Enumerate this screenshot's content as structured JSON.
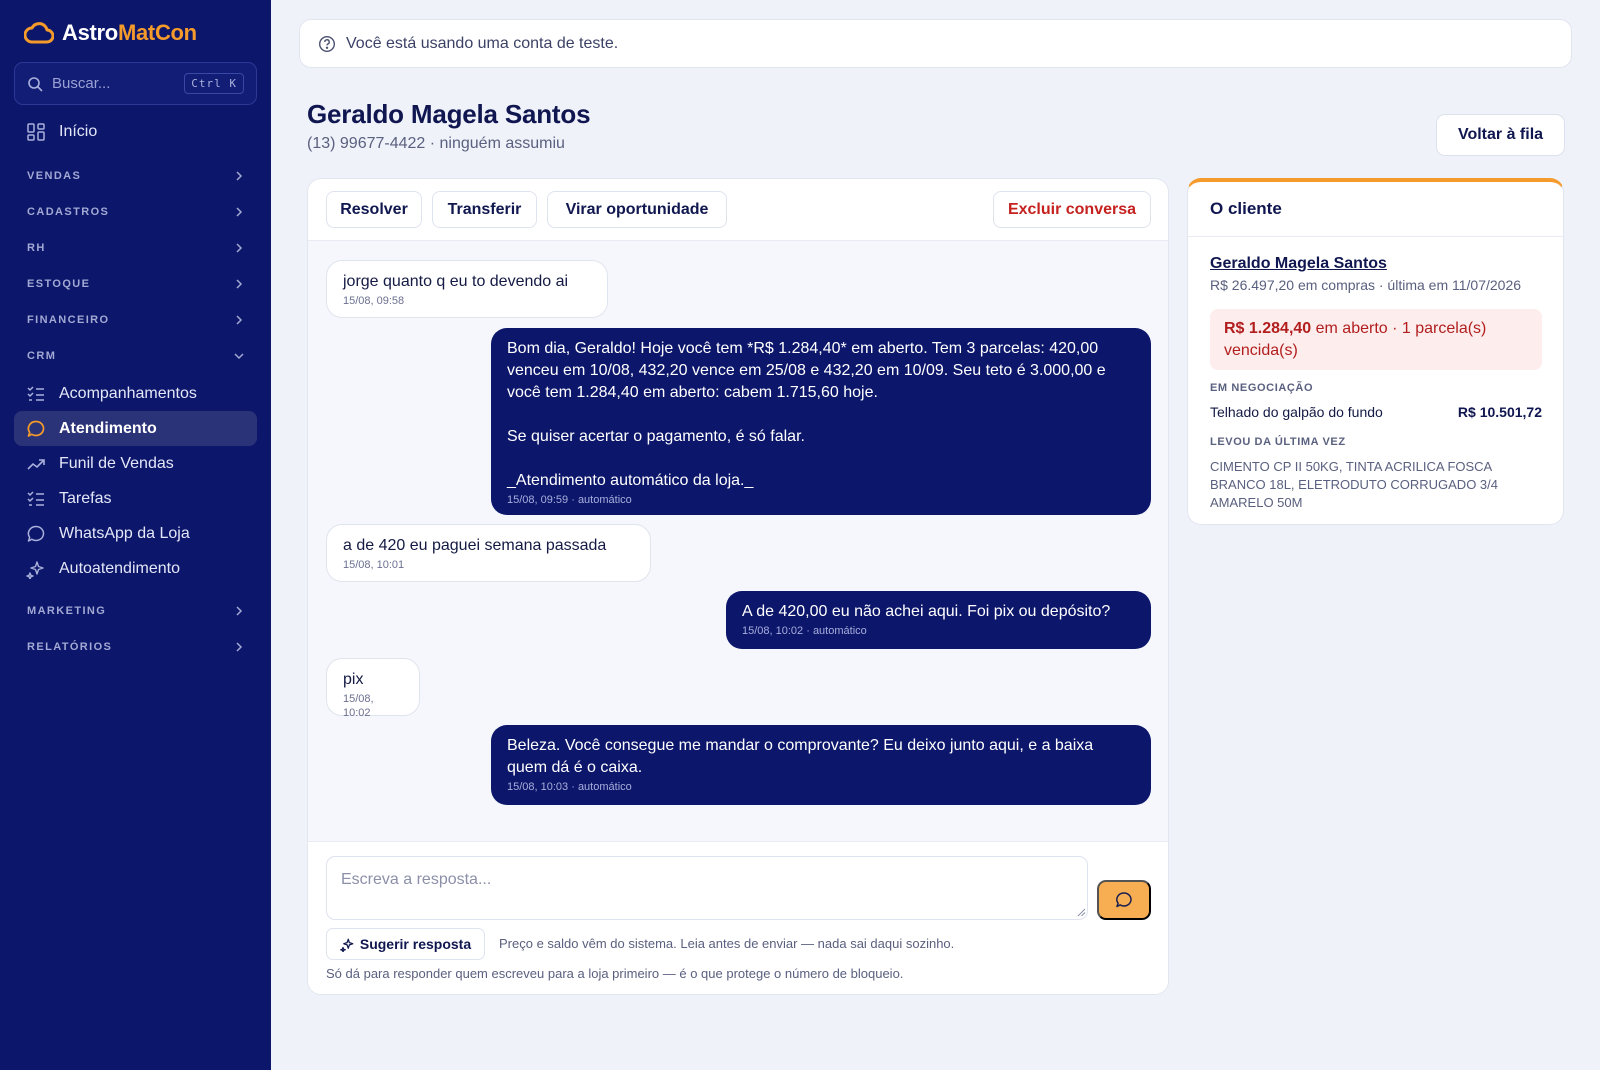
{
  "sidebar": {
    "logo_part1": "Astro",
    "logo_part2": "MatCon",
    "search_placeholder": "Buscar...",
    "search_shortcut": "Ctrl K",
    "home_label": "Início",
    "sections": [
      "VENDAS",
      "CADASTROS",
      "RH",
      "ESTOQUE",
      "FINANCEIRO",
      "CRM",
      "MARKETING",
      "RELATÓRIOS"
    ],
    "crm_items": [
      "Acompanhamentos",
      "Atendimento",
      "Funil de Vendas",
      "Tarefas",
      "WhatsApp da Loja",
      "Autoatendimento"
    ],
    "active_item": "Atendimento"
  },
  "banner": {
    "text": "Você está usando uma conta de teste."
  },
  "header": {
    "title": "Geraldo Magela Santos",
    "subtitle": "(13) 99677-4422 · ninguém assumiu",
    "back_button": "Voltar à fila"
  },
  "toolbar": {
    "resolve": "Resolver",
    "transfer": "Transferir",
    "opportunity": "Virar oportunidade",
    "delete": "Excluir conversa"
  },
  "messages": [
    {
      "direction": "in",
      "text": "jorge quanto q eu to devendo ai",
      "meta": "15/08, 09:58"
    },
    {
      "direction": "out",
      "text": "Bom dia, Geraldo! Hoje você tem *R$ 1.284,40* em aberto. Tem 3 parcelas: 420,00 venceu em 10/08, 432,20 vence em 25/08 e 432,20 em 10/09. Seu teto é 3.000,00 e você tem 1.284,40 em aberto: cabem 1.715,60 hoje.\n\nSe quiser acertar o pagamento, é só falar.\n\n_Atendimento automático da loja._",
      "meta": "15/08, 09:59 · automático"
    },
    {
      "direction": "in",
      "text": "a de 420 eu paguei semana passada",
      "meta": "15/08, 10:01"
    },
    {
      "direction": "out",
      "text": "A de 420,00 eu não achei aqui. Foi pix ou depósito?",
      "meta": "15/08, 10:02 · automático"
    },
    {
      "direction": "in",
      "text": "pix",
      "meta": "15/08, 10:02"
    },
    {
      "direction": "out",
      "text": "Beleza. Você consegue me mandar o comprovante? Eu deixo junto aqui, e a baixa quem dá é o caixa.",
      "meta": "15/08, 10:03 · automático"
    }
  ],
  "composer": {
    "placeholder": "Escreva a resposta...",
    "value": "",
    "suggest_button": "Sugerir resposta",
    "hint": "Preço e saldo vêm do sistema. Leia antes de enviar — nada sai daqui sozinho.",
    "footnote": "Só dá para responder quem escreveu para a loja primeiro — é o que protege o número de bloqueio."
  },
  "client": {
    "title": "O cliente",
    "name": "Geraldo Magela Santos",
    "summary": "R$ 26.497,20 em compras · última em 11/07/2026",
    "alert_amount": "R$ 1.284,40",
    "alert_text": " em aberto · 1 parcela(s) vencida(s)",
    "negotiation_label": "EM NEGOCIAÇÃO",
    "negotiation_item": "Telhado do galpão do fundo",
    "negotiation_value": "R$ 10.501,72",
    "last_label": "LEVOU DA ÚLTIMA VEZ",
    "last_items": "CIMENTO CP II 50KG, TINTA ACRILICA FOSCA BRANCO 18L, ELETRODUTO CORRUGADO 3/4 AMARELO 50M"
  },
  "colors": {
    "sidebar_bg": "#0c166a",
    "accent_orange": "#f59b2b",
    "danger_red": "#c5221f",
    "outgoing_bubble": "#0c166a"
  }
}
